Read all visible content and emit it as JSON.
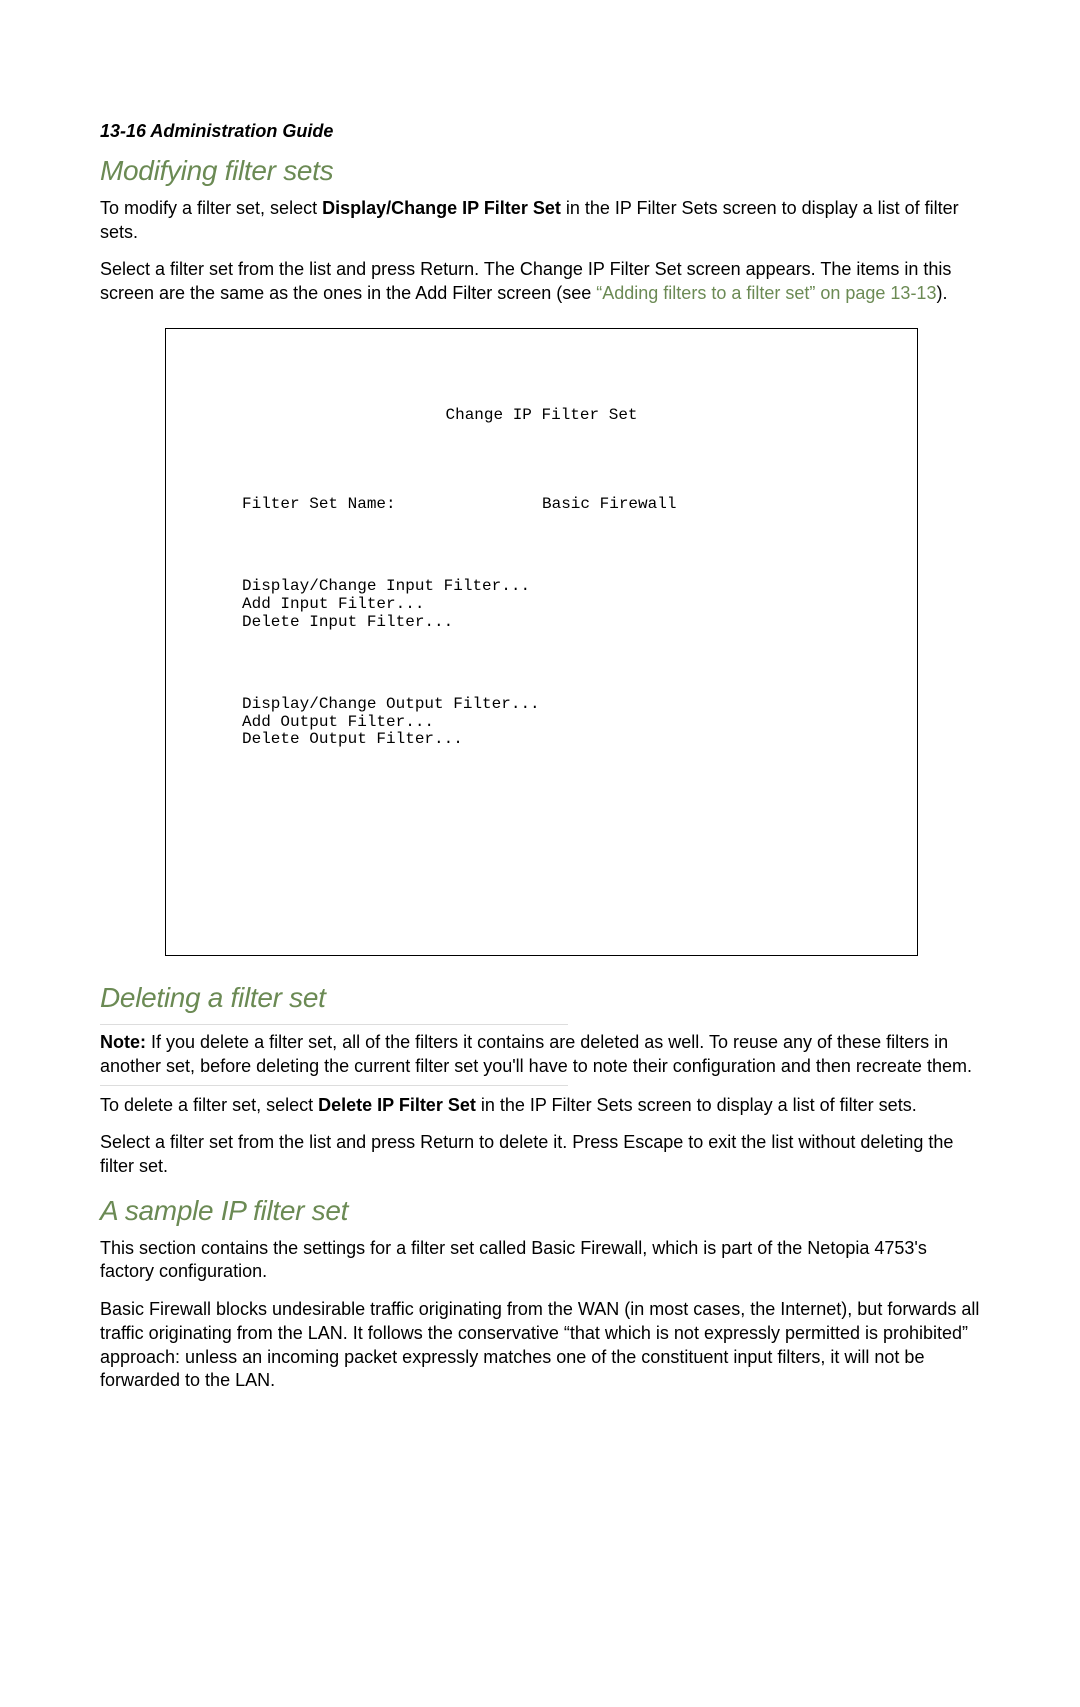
{
  "header": "13-16  Administration Guide",
  "section1": {
    "title": "Modifying filter sets",
    "p1_a": "To modify a filter set, select ",
    "p1_bold": "Display/Change IP Filter Set",
    "p1_b": " in the IP Filter Sets screen to display a list of filter sets.",
    "p2_a": "Select a filter set from the list and press Return. The Change IP Filter Set screen appears. The items in this screen are the same as the ones in the Add Filter screen (see ",
    "p2_link": "“Adding filters to a filter set” on page 13-13",
    "p2_b": ")."
  },
  "terminal": {
    "title": "Change IP Filter Set",
    "name_label": "Filter Set Name:",
    "name_value": "Basic Firewall",
    "block1": "Display/Change Input Filter...\nAdd Input Filter...\nDelete Input Filter...",
    "block2": "Display/Change Output Filter...\nAdd Output Filter...\nDelete Output Filter..."
  },
  "section2": {
    "title": "Deleting a filter set",
    "note_label": "Note:",
    "note_text": " If you delete a filter set, all of the filters it contains are deleted as well. To reuse any of these filters in another set, before deleting the current filter set you'll have to note their configuration and then recreate them.",
    "p1_a": "To delete a filter set, select ",
    "p1_bold": "Delete IP Filter Set",
    "p1_b": " in the IP Filter Sets screen to display a list of filter sets.",
    "p2": "Select a filter set from the list and press Return to delete it. Press Escape to exit the list without deleting the filter set."
  },
  "section3": {
    "title": "A sample IP filter set",
    "p1": "This section contains the settings for a filter set called Basic Firewall, which is part of the Netopia 4753's factory configuration.",
    "p2": "Basic Firewall blocks undesirable traffic originating from the WAN (in most cases, the Internet), but forwards all traffic originating from the LAN. It follows the conservative “that which is not expressly permitted is prohibited” approach: unless an incoming packet expressly matches one of the constituent input filters, it will not be forwarded to the LAN."
  }
}
